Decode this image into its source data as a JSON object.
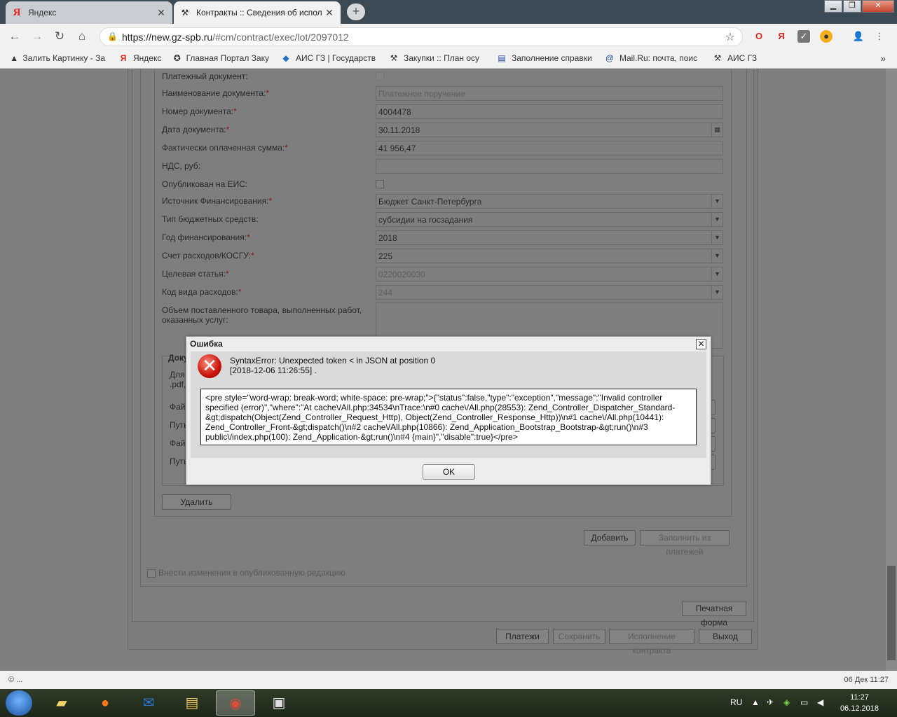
{
  "browser": {
    "tabs": [
      {
        "title": "Яндекс",
        "active": false
      },
      {
        "title": "Контракты :: Сведения об испол",
        "active": true
      }
    ],
    "url_host": "https://new.gz-spb.ru",
    "url_path": "/#cm/contract/exec/lot/2097012",
    "bookmarks": [
      "Залить Картинку - За",
      "Яндекс",
      "Главная Портал Заку",
      "АИС ГЗ | Государств",
      "Закупки :: План осу",
      "Заполнение справки",
      "Mail.Ru: почта, поис",
      "АИС ГЗ"
    ]
  },
  "form": {
    "fields": [
      {
        "label": "Платежный документ:",
        "required": false,
        "type": "checkbox"
      },
      {
        "label": "Наименование документа:",
        "required": true,
        "value": "Платежное поручение",
        "disabled": true
      },
      {
        "label": "Номер документа:",
        "required": true,
        "value": "4004478"
      },
      {
        "label": "Дата документа:",
        "required": true,
        "value": "30.11.2018"
      },
      {
        "label": "Фактически оплаченная сумма:",
        "required": true,
        "value": "41 956,47"
      },
      {
        "label": "НДС, руб:",
        "required": false,
        "value": ""
      },
      {
        "label": "Опубликован на ЕИС:",
        "required": false,
        "type": "checkbox"
      },
      {
        "label": "Источник Финансирования:",
        "required": true,
        "value": "Бюджет Санкт-Петербурга"
      },
      {
        "label": "Тип бюджетных средств:",
        "required": false,
        "value": "субсидии на госзадания"
      },
      {
        "label": "Год финансирования:",
        "required": true,
        "value": "2018"
      },
      {
        "label": "Счет расходов/КОСГУ:",
        "required": true,
        "value": "225"
      },
      {
        "label": "Целевая статья:",
        "required": true,
        "value": "0220020030",
        "disabled": true
      },
      {
        "label": "Код вида расходов:",
        "required": true,
        "value": "244",
        "disabled": true
      }
    ],
    "volume_label_1": "Объем поставленного товара, выполненных работ,",
    "volume_label_2": "оказанных услуг:",
    "doc_group_partial": "Доку",
    "doc_hint_1": "Для",
    "doc_hint_2": ".pdf,",
    "file_label_1": "Фай",
    "path_label_1": "Путь",
    "file_label_2": "Фай",
    "path_label_2": "Путь",
    "delete_button": "Удалить",
    "add_button": "Добавить",
    "fill_from_payments_button": "Заполнить из платежей",
    "publish_changes_label": "Внести изменения в опубликованную редакцию",
    "print_form_button": "Печатная форма",
    "payments_button": "Платежи",
    "save_button": "Сохранить",
    "contract_execution_button": "Исполнение контракта",
    "exit_button": "Выход"
  },
  "status": {
    "left": "© ...",
    "right": "06 Дек 11:27"
  },
  "dialog": {
    "title": "Ошибка",
    "message_line1": "SyntaxError: Unexpected token < in JSON at position 0",
    "message_line2": "[2018-12-06 11:26:55] .",
    "detail": "<pre style=\"word-wrap: break-word; white-space: pre-wrap;\">{\"status\":false,\"type\":\"exception\",\"message\":\"Invalid controller specified (error)\",\"where\":\"At cache\\/All.php:34534\\nTrace:\\n#0 cache\\/All.php(28553): Zend_Controller_Dispatcher_Standard-&gt;dispatch(Object(Zend_Controller_Request_Http), Object(Zend_Controller_Response_Http))\\n#1 cache\\/All.php(10441): Zend_Controller_Front-&gt;dispatch()\\n#2 cache\\/All.php(10866): Zend_Application_Bootstrap_Bootstrap-&gt;run()\\n#3 public\\/index.php(100): Zend_Application-&gt;run()\\n#4 {main}\",\"disable\":true}</pre>",
    "ok_button": "OK"
  },
  "taskbar": {
    "lang": "RU",
    "time": "11:27",
    "date": "06.12.2018"
  }
}
